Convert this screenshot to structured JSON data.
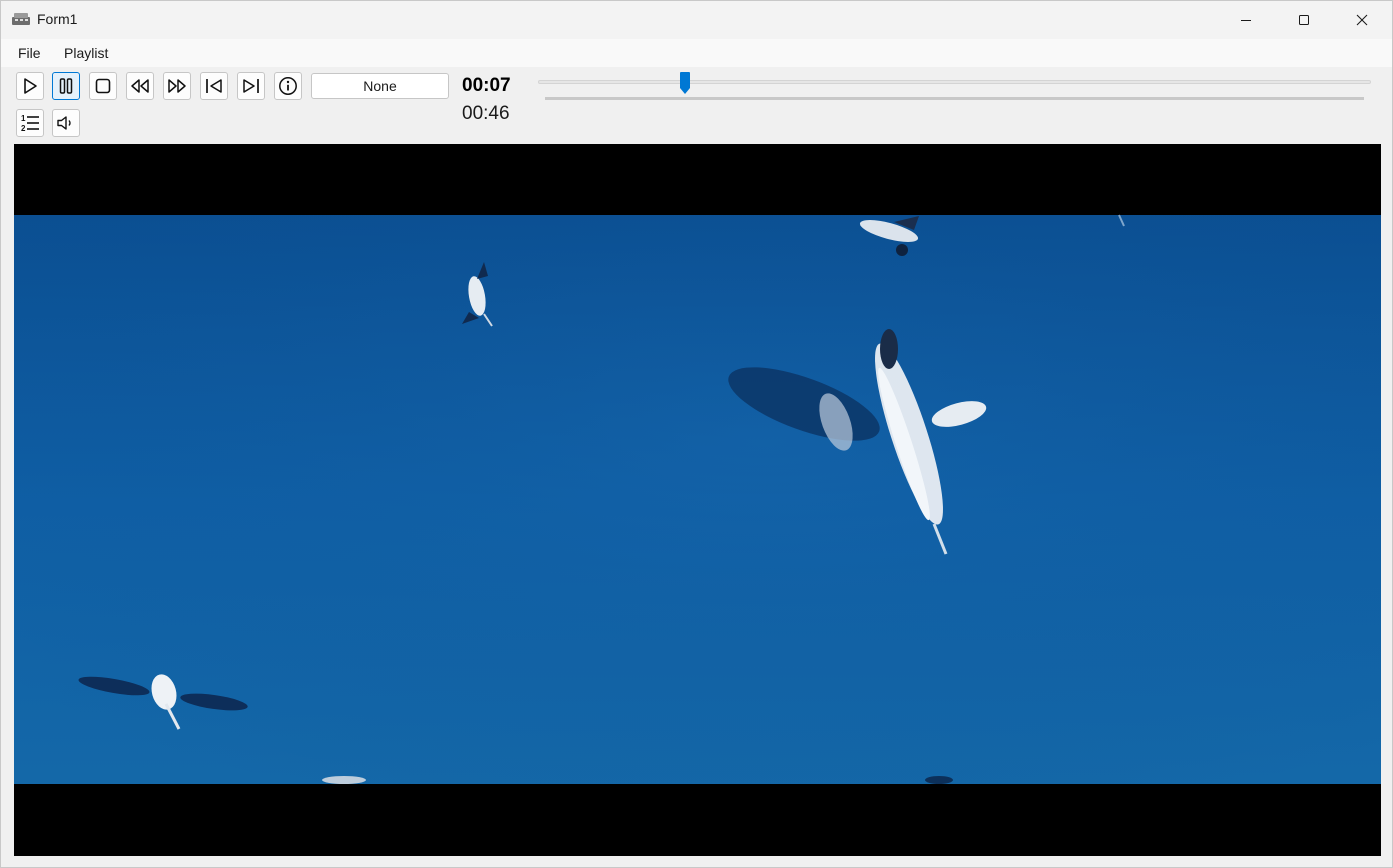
{
  "window": {
    "title": "Form1",
    "icons": {
      "app": "app-icon",
      "minimize": "minimize-icon",
      "maximize": "maximize-icon",
      "close": "close-icon"
    }
  },
  "menu": {
    "items": [
      {
        "label": "File"
      },
      {
        "label": "Playlist"
      }
    ]
  },
  "toolbar": {
    "buttons": [
      {
        "name": "play",
        "icon": "play-icon"
      },
      {
        "name": "pause",
        "icon": "pause-icon",
        "active": true
      },
      {
        "name": "stop",
        "icon": "stop-icon"
      },
      {
        "name": "rewind",
        "icon": "rewind-icon"
      },
      {
        "name": "fast-forward",
        "icon": "fast-forward-icon"
      },
      {
        "name": "previous",
        "icon": "skip-previous-icon"
      },
      {
        "name": "next",
        "icon": "skip-next-icon"
      },
      {
        "name": "info",
        "icon": "info-icon"
      },
      {
        "name": "playlist",
        "icon": "numbered-list-icon"
      },
      {
        "name": "volume",
        "icon": "speaker-icon"
      }
    ],
    "status_text": "None",
    "accent_color": "#0078d4"
  },
  "playback": {
    "current_time": "00:07",
    "total_time": "00:46",
    "progress_fraction": 0.176
  },
  "video": {
    "content": "video-frame",
    "background_color": "#000000",
    "sky_color": "#0e5ea3"
  }
}
